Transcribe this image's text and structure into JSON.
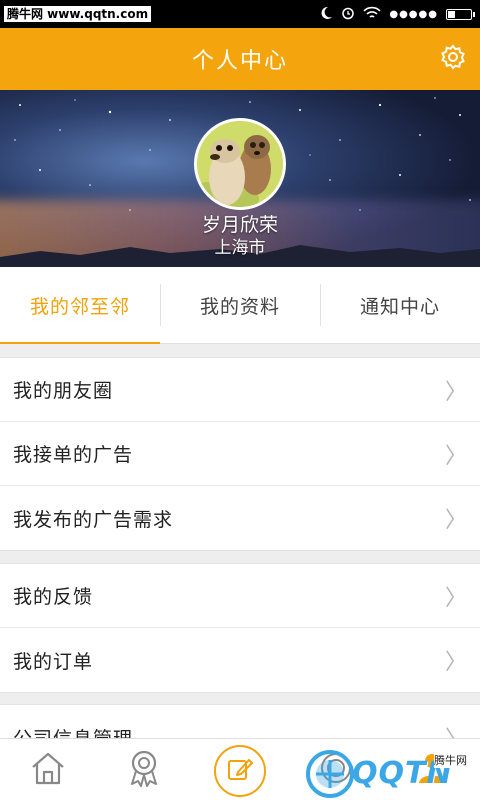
{
  "statusbar": {
    "watermark": "腾牛网 www.qqtn.com",
    "battery_level": 0.3
  },
  "header": {
    "title": "个人中心"
  },
  "profile": {
    "name": "岁月欣荣",
    "location": "上海市"
  },
  "tabs": [
    {
      "label": "我的邻至邻",
      "active": true
    },
    {
      "label": "我的资料",
      "active": false
    },
    {
      "label": "通知中心",
      "active": false
    }
  ],
  "menu": {
    "group1": [
      {
        "label": "我的朋友圈"
      },
      {
        "label": "我接单的广告"
      },
      {
        "label": "我发布的广告需求"
      }
    ],
    "group2": [
      {
        "label": "我的反馈"
      },
      {
        "label": "我的订单"
      }
    ],
    "group3": [
      {
        "label": "公司信息管理"
      }
    ],
    "chevron": "〉"
  },
  "bottom_nav": {
    "items": [
      "home-icon",
      "badge-icon",
      "compose-icon",
      "target-icon",
      "profile-icon"
    ]
  },
  "watermark": {
    "logo_text": "QQTN",
    "tag": "腾牛网"
  },
  "colors": {
    "accent": "#f4a50e",
    "tab_active": "#f2a20b",
    "watermark_blue": "#3ba7e6"
  }
}
